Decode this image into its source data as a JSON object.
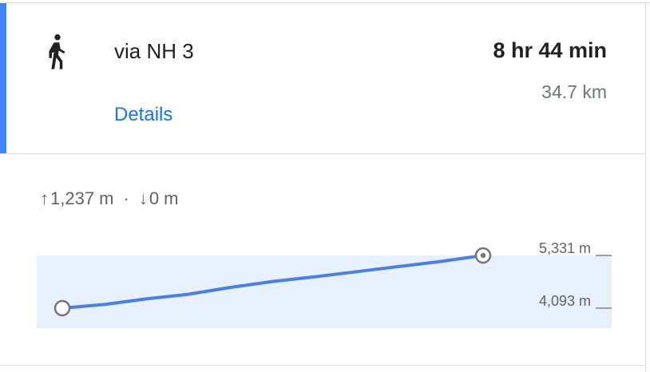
{
  "route": {
    "mode_icon": "walk-icon",
    "name": "via NH 3",
    "duration": "8 hr 44 min",
    "distance": "34.7 km",
    "details_label": "Details"
  },
  "elevation": {
    "ascent_arrow": "↑",
    "ascent": "1,237 m",
    "separator": "·",
    "descent_arrow": "↓",
    "descent": "0 m"
  },
  "colors": {
    "accent": "#4285f4",
    "profile_line": "#4b7fe0",
    "profile_fill": "#e8f0fe",
    "link": "#1a73e8"
  },
  "chart_data": {
    "type": "area",
    "xlabel": "",
    "ylabel": "",
    "y_tick_labels": [
      "5,331 m",
      "4,093 m"
    ],
    "y_ticks": [
      5331,
      4093
    ],
    "x": [
      0,
      0.1,
      0.2,
      0.3,
      0.4,
      0.5,
      0.6,
      0.7,
      0.8,
      0.9,
      1.0
    ],
    "series": [
      {
        "values": [
          4093,
          4180,
          4310,
          4420,
          4580,
          4720,
          4830,
          4950,
          5070,
          5190,
          5331
        ]
      }
    ],
    "ylim": [
      4093,
      5331
    ],
    "grid": false
  }
}
